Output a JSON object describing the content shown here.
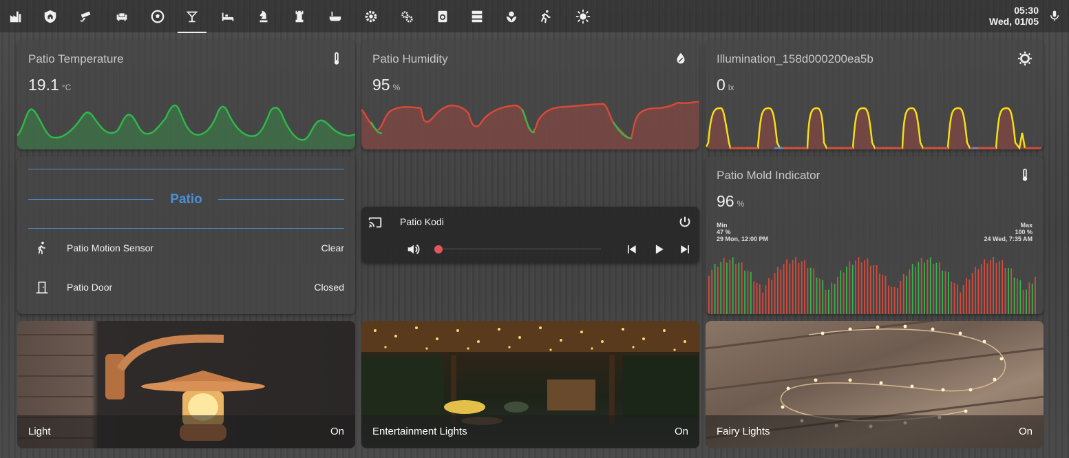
{
  "header": {
    "tabs": [
      {
        "icon": "factory-icon"
      },
      {
        "icon": "home-shield-icon"
      },
      {
        "icon": "cctv-icon"
      },
      {
        "icon": "sofa-icon"
      },
      {
        "icon": "soccer-icon"
      },
      {
        "icon": "glass-cocktail-icon",
        "active": true
      },
      {
        "icon": "bed-icon"
      },
      {
        "icon": "chess-knight-icon"
      },
      {
        "icon": "chess-rook-icon"
      },
      {
        "icon": "bathtub-icon"
      },
      {
        "icon": "settings-icon"
      },
      {
        "icon": "settings-multiple-icon"
      },
      {
        "icon": "washing-machine-icon"
      },
      {
        "icon": "server-icon"
      },
      {
        "icon": "flower-icon"
      },
      {
        "icon": "run-icon"
      },
      {
        "icon": "weather-sunny-icon"
      }
    ],
    "time": "05:30",
    "date": "Wed, 01/05"
  },
  "sensors": {
    "patio_temperature": {
      "title": "Patio Temperature",
      "value": "19.1",
      "unit": "°C",
      "icon": "thermometer-icon"
    },
    "patio_humidity": {
      "title": "Patio Humidity",
      "value": "95",
      "unit": "%",
      "icon": "water-percent-icon"
    },
    "illumination": {
      "title": "Illumination_158d000200ea5b",
      "value": "0",
      "unit": "lx",
      "icon": "brightness-icon"
    }
  },
  "entities": {
    "header": "Patio",
    "rows": [
      {
        "name": "Patio Motion Sensor",
        "state": "Clear",
        "icon": "walk-icon"
      },
      {
        "name": "Patio Door",
        "state": "Closed",
        "icon": "door-closed-icon"
      }
    ]
  },
  "media": {
    "name": "Patio Kodi",
    "progress": 0,
    "icon": "cast-icon"
  },
  "mold": {
    "title": "Patio Mold Indicator",
    "value": "96",
    "unit": "%",
    "icon": "thermometer-icon",
    "min_label": "Min",
    "min_value": "47 %",
    "min_time": "29 Mon, 12:00 PM",
    "max_label": "Max",
    "max_value": "100 %",
    "max_time": "24 Wed, 7:35 AM"
  },
  "lights": [
    {
      "name": "Light",
      "state": "On"
    },
    {
      "name": "Entertainment Lights",
      "state": "On"
    },
    {
      "name": "Fairy Lights",
      "state": "On"
    }
  ],
  "colors": {
    "accent": "#4a90d9",
    "green": "#2fb84a",
    "red": "#d9493a",
    "yellow": "#f3e014"
  }
}
